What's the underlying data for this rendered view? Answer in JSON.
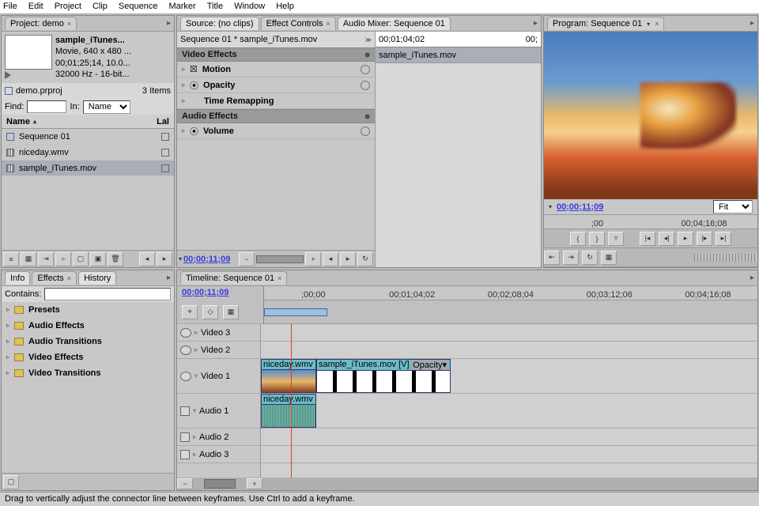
{
  "menu": [
    "File",
    "Edit",
    "Project",
    "Clip",
    "Sequence",
    "Marker",
    "Title",
    "Window",
    "Help"
  ],
  "project": {
    "title": "Project: demo",
    "clip_name": "sample_iTunes...",
    "info1": "Movie, 640 x 480 ...",
    "info2": "00;01;25;14, 10.0...",
    "info3": "32000 Hz - 16-bit...",
    "file": "demo.prproj",
    "items": "3 Items",
    "find_label": "Find:",
    "in_label": "In:",
    "in_value": "Name",
    "col_name": "Name",
    "col_label": "Lal",
    "bins": [
      {
        "name": "Sequence 01",
        "type": "seq"
      },
      {
        "name": "niceday.wmv",
        "type": "clip"
      },
      {
        "name": "sample_iTunes.mov",
        "type": "clip",
        "sel": true
      }
    ]
  },
  "source_tab": "Source: (no clips)",
  "effect_controls_tab": "Effect Controls",
  "audio_mixer_tab": "Audio Mixer: Sequence 01",
  "ec": {
    "breadcrumb": "Sequence 01 * sample_iTunes.mov",
    "tc": "00;01;04;02",
    "tc2": "00;",
    "clip_name": "sample_iTunes.mov",
    "video_effects": "Video Effects",
    "audio_effects": "Audio Effects",
    "fx": [
      "Motion",
      "Opacity",
      "Time Remapping"
    ],
    "afx": [
      "Volume"
    ],
    "bottom_tc": "00;00;11;09"
  },
  "program": {
    "title": "Program: Sequence 01",
    "tc": "00;00;11;09",
    "fit": "Fit",
    "ruler": [
      ";00",
      "00;04;16;08"
    ]
  },
  "effects_panel": {
    "tabs": [
      "Info",
      "Effects",
      "History"
    ],
    "contains": "Contains:",
    "folders": [
      "Presets",
      "Audio Effects",
      "Audio Transitions",
      "Video Effects",
      "Video Transitions"
    ]
  },
  "timeline": {
    "title": "Timeline: Sequence 01",
    "tc": "00;00;11;09",
    "ruler": [
      ";00;00",
      "00;01;04;02",
      "00;02;08;04",
      "00;03;12;06",
      "00;04;16;08"
    ],
    "tracks": {
      "v3": "Video 3",
      "v2": "Video 2",
      "v1": "Video 1",
      "a1": "Audio 1",
      "a2": "Audio 2",
      "a3": "Audio 3"
    },
    "clips": {
      "v1_a": "niceday.wmv",
      "v1_b": "sample_iTunes.mov [V]",
      "v1_b_fx": "Opacity",
      "a1": "niceday.wmv"
    }
  },
  "status": "Drag to vertically adjust the connector line between keyframes. Use Ctrl to add a keyframe."
}
